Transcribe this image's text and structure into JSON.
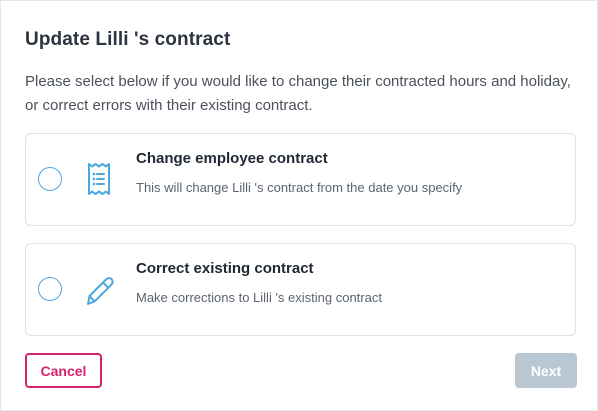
{
  "dialog": {
    "title": "Update Lilli 's contract",
    "description": "Please select below if you would like to change their contracted hours and holiday, or correct errors with their existing contract."
  },
  "options": [
    {
      "title": "Change employee contract",
      "subtitle": "This will change Lilli 's contract from the date you specify",
      "icon": "receipt-icon",
      "selected": false
    },
    {
      "title": "Correct existing contract",
      "subtitle": "Make corrections to Lilli 's existing contract",
      "icon": "pencil-icon",
      "selected": false
    }
  ],
  "buttons": {
    "cancel_label": "Cancel",
    "next_label": "Next",
    "next_disabled": true
  },
  "colors": {
    "accent": "#d5226f",
    "icon_blue": "#4aa8e0",
    "disabled": "#b9c7d3"
  }
}
